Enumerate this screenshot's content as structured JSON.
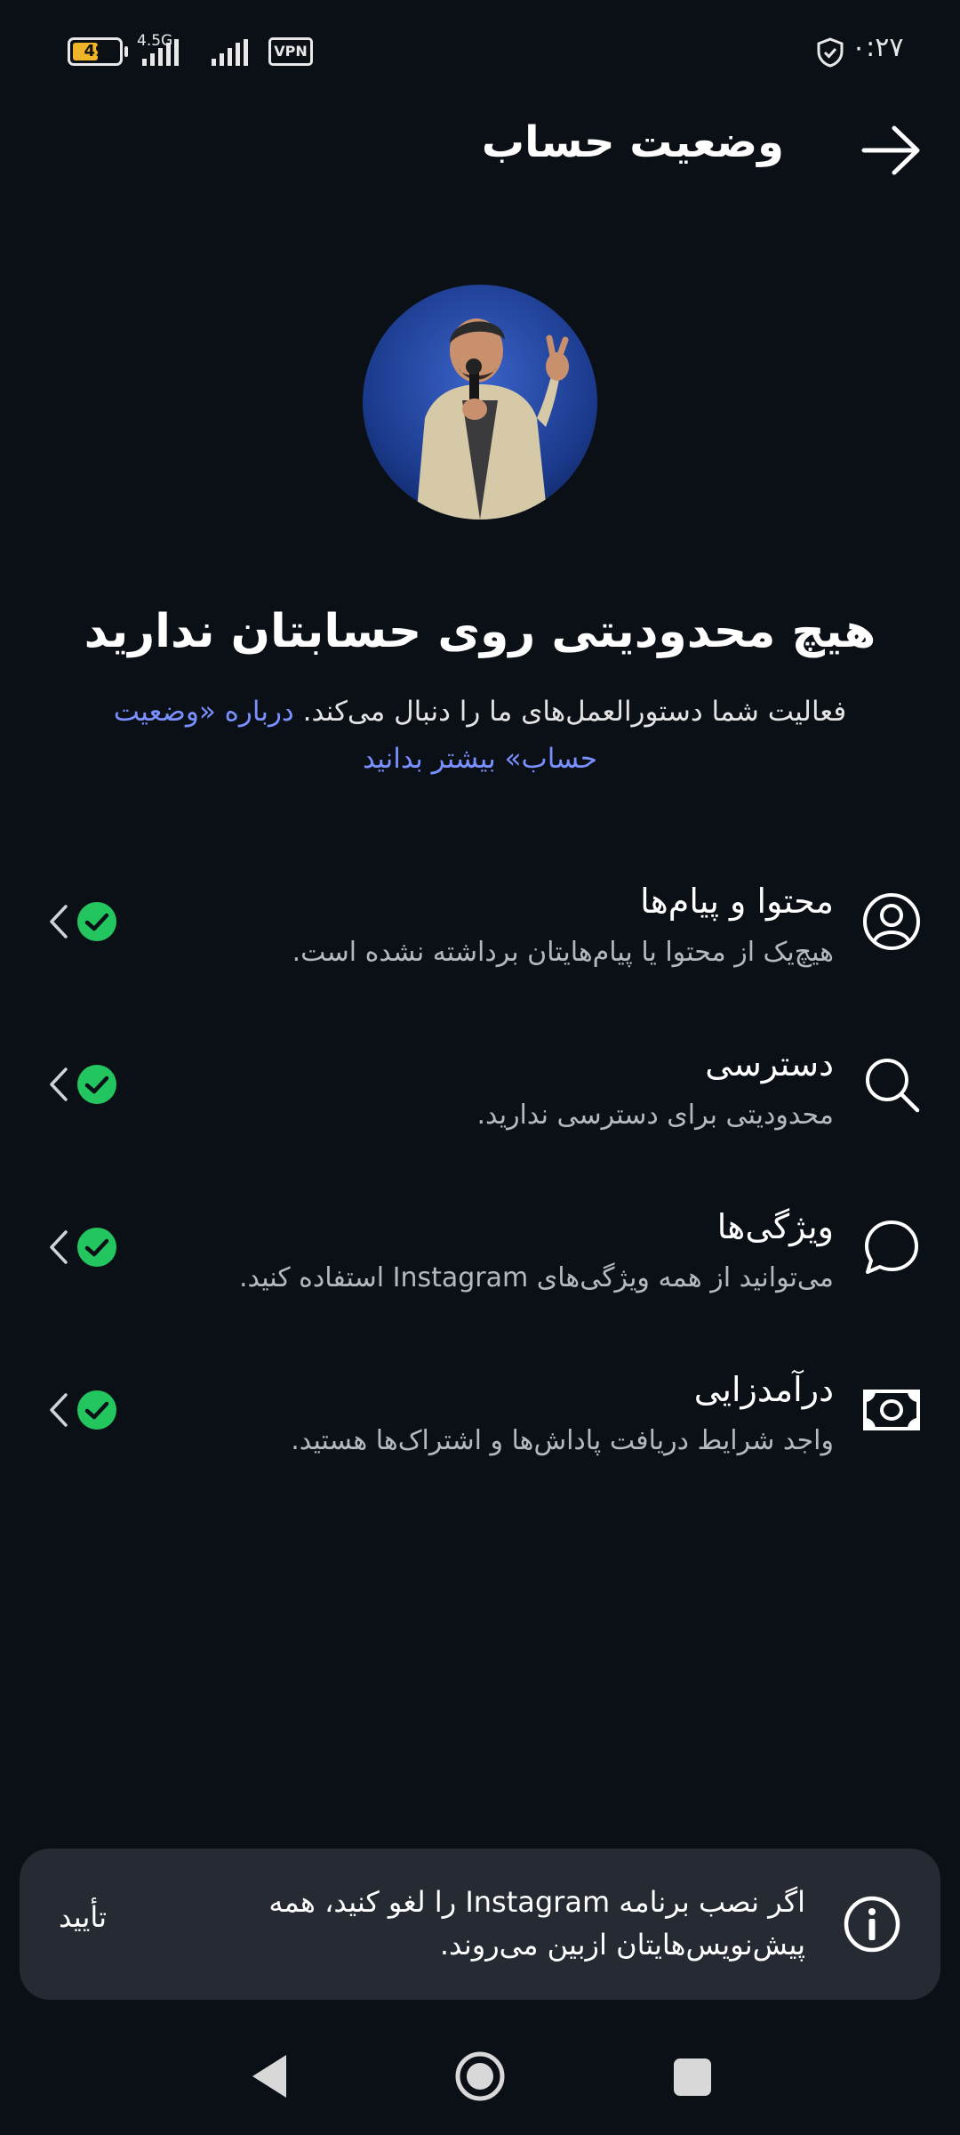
{
  "status_bar": {
    "battery": "49",
    "network": "4.5G",
    "vpn": "VPN",
    "time": "۰:۲۷"
  },
  "header": {
    "title": "وضعیت حساب"
  },
  "summary": {
    "headline": "هیچ محدودیتی روی حسابتان ندارید",
    "text": "فعالیت شما دستورالعمل‌های ما را دنبال می‌کند.",
    "link": "درباره «وضعیت حساب» بیشتر بدانید"
  },
  "rows": [
    {
      "title": "محتوا و پیام‌ها",
      "description": "هیچ‌یک از محتوا یا پیام‌هایتان برداشته نشده است.",
      "icon": "user-circle-icon"
    },
    {
      "title": "دسترسی",
      "description": "محدودیتی برای دسترسی ندارید.",
      "icon": "search-icon"
    },
    {
      "title": "ویژگی‌ها",
      "description": "می‌توانید از همه ویژگی‌های Instagram استفاده کنید.",
      "icon": "chat-bubble-icon"
    },
    {
      "title": "درآمدزایی",
      "description": "واجد شرایط دریافت پاداش‌ها و اشتراک‌ها هستید.",
      "icon": "money-icon"
    }
  ],
  "snackbar": {
    "message": "اگر نصب برنامه Instagram را لغو کنید، همه پیش‌نویس‌هایتان ازبین می‌روند.",
    "action": "تأیید"
  },
  "colors": {
    "background": "#0b0f16",
    "accent_link": "#7a90ff",
    "check": "#22c55e",
    "snackbar": "#262a33"
  }
}
